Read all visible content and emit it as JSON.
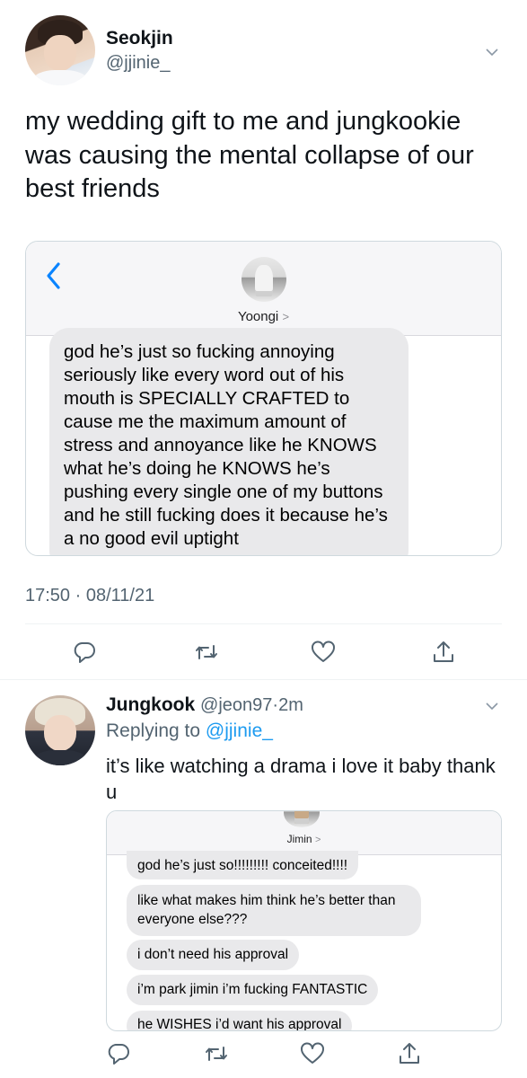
{
  "main_tweet": {
    "display_name": "Seokjin",
    "handle": "@jjinie_",
    "text": "my wedding gift to me and jungkookie was causing the mental collapse of our best friends",
    "message_card": {
      "contact_name": "Yoongi",
      "contact_chevron": ">",
      "message": "god he’s just so fucking annoying seriously like every word out of his mouth is SPECIALLY CRAFTED to cause me the maximum amount of stress and annoyance like he KNOWS what he’s doing he KNOWS he’s pushing every single one of my buttons and he still fucking does it because he’s a no good evil uptight"
    },
    "time": "17:50",
    "date": "08/11/21",
    "meta_sep": "·"
  },
  "reply_tweet": {
    "display_name": "Jungkook",
    "handle": "@jeon97",
    "time_ago": "2m",
    "meta_sep": "·",
    "replying_to_label": "Replying to",
    "replying_to_handle": "@jjinie_",
    "text": "it’s like watching a drama i love it baby thank u",
    "message_card": {
      "contact_name": "Jimin",
      "contact_chevron": ">",
      "messages": [
        "god he’s just so!!!!!!!!! conceited!!!!",
        "like what makes him think he’s better than everyone else???",
        "i don’t need his approval",
        "i’m park jimin i’m fucking FANTASTIC",
        "he WISHES i’d want his approval"
      ]
    }
  },
  "actions": [
    "reply-icon",
    "retweet-icon",
    "like-icon",
    "share-icon"
  ],
  "colors": {
    "accent": "#1d9bf0",
    "secondary_text": "#536471",
    "imessage_back": "#0a84ff",
    "bubble_gray": "#e9e9eb"
  }
}
